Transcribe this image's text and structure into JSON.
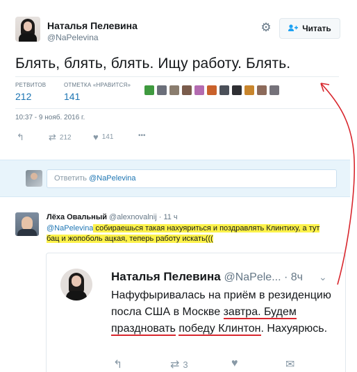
{
  "tweet": {
    "author_name": "Наталья Пелевина",
    "author_handle": "@NaPelevina",
    "follow_label": "Читать",
    "text": "Блять, блять, блять. Ищу работу. Блять.",
    "retweets_label": "РЕТВИТОВ",
    "retweets_count": "212",
    "likes_label": "ОТМЕТКА «НРАВИТСЯ»",
    "likes_count": "141",
    "timestamp": "10:37 - 9 нояб. 2016 г.",
    "actions": {
      "retweet_count": "212",
      "like_count": "141",
      "more": "•••"
    },
    "liker_colors": [
      "#3f9a3f",
      "#6b6f7a",
      "#8a7d6e",
      "#7a5c4c",
      "#b36bb0",
      "#c9612b",
      "#4b5059",
      "#2e2f33",
      "#c8852c",
      "#8c6a5a",
      "#75727a"
    ]
  },
  "reply_box": {
    "prefix": "Ответить ",
    "mention": "@NaPelevina"
  },
  "reply": {
    "author_name": "Лёха Овальный",
    "author_handle": "@alexnovalnij · 11 ч",
    "mention": "@NaPelevina",
    "text_line1": " собираешься такая нахуяриться и поздравлять Клинтиху, а тут",
    "text_line2": "бац и жопоболь ацкая, теперь работу искать((("
  },
  "quoted": {
    "author_name": "Наталья Пелевина",
    "author_handle": "@NaPele... · 8ч",
    "text_part1": "Нафуфыривалась на приём в резиденцию посла США в Москве ",
    "text_ul1": "завтра. Будем праздновать",
    "text_part2": " ",
    "text_ul2": "победу Клинтон",
    "text_part3": ". Нахуярюсь.",
    "retweet_count": "3"
  },
  "colors": {
    "accent": "#1da1f2",
    "link": "#1d75b3",
    "highlight": "#fdf24a",
    "annotation": "#d8262d"
  }
}
